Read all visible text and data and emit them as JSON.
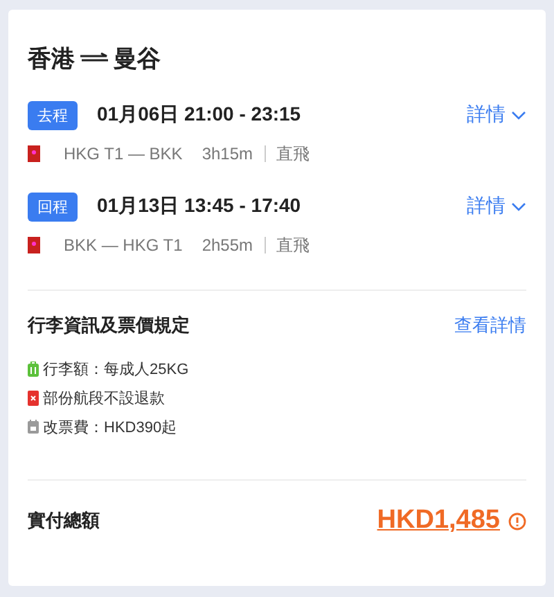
{
  "title": {
    "from": "香港",
    "to": "曼谷"
  },
  "segments": [
    {
      "tag": "去程",
      "datetime": "01月06日 21:00 - 23:15",
      "details": "詳情",
      "route": "HKG T1 — BKK",
      "duration": "3h15m",
      "type": "直飛"
    },
    {
      "tag": "回程",
      "datetime": "01月13日 13:45 - 17:40",
      "details": "詳情",
      "route": "BKK — HKG T1",
      "duration": "2h55m",
      "type": "直飛"
    }
  ],
  "rules": {
    "title": "行李資訊及票價規定",
    "link": "查看詳情",
    "items": [
      {
        "kind": "baggage",
        "text": "行李額：每成人25KG"
      },
      {
        "kind": "refund",
        "text": "部份航段不設退款"
      },
      {
        "kind": "change",
        "text": "改票費：HKD390起"
      }
    ]
  },
  "total": {
    "label": "實付總額",
    "amount": "HKD1,485"
  }
}
